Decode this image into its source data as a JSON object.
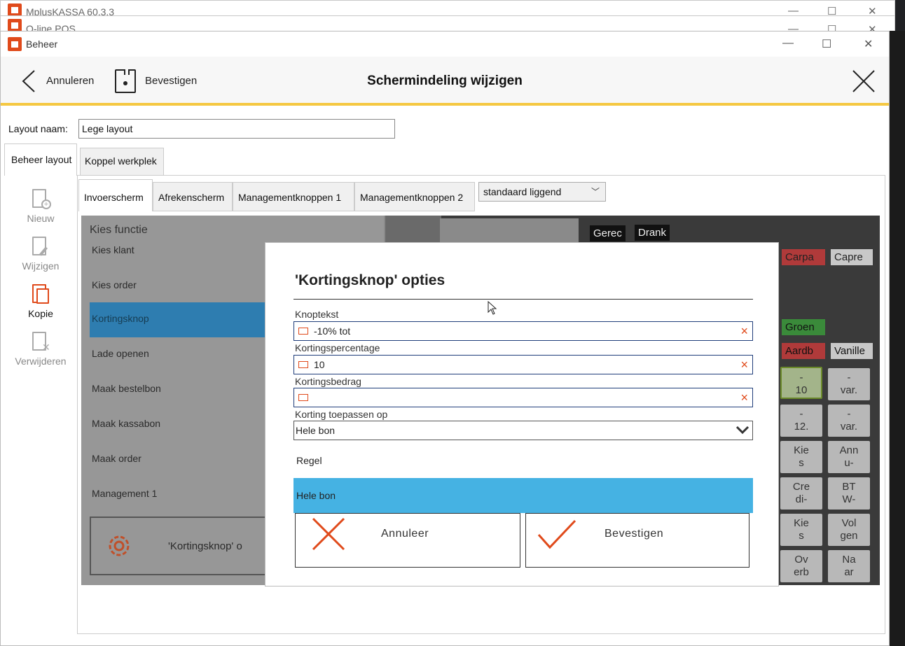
{
  "background_windows": [
    {
      "title": "MplusKASSA 60.3.3"
    },
    {
      "title": "Q-line POS"
    }
  ],
  "window": {
    "title": "Beheer",
    "controls": {
      "minimize": "—",
      "maximize": "☐",
      "close": "✕"
    }
  },
  "header": {
    "cancel_label": "Annuleren",
    "confirm_label": "Bevestigen",
    "title": "Schermindeling wijzigen"
  },
  "layout_name": {
    "label": "Layout naam:",
    "value": "Lege layout"
  },
  "top_tabs": [
    {
      "label": "Beheer layout",
      "active": true
    },
    {
      "label": "Koppel werkplek",
      "active": false
    }
  ],
  "sidebar": {
    "items": [
      {
        "label": "Nieuw",
        "icon": "new-document-icon",
        "enabled": false
      },
      {
        "label": "Wijzigen",
        "icon": "edit-document-icon",
        "enabled": false
      },
      {
        "label": "Kopie",
        "icon": "copy-document-icon",
        "enabled": true
      },
      {
        "label": "Verwijderen",
        "icon": "delete-document-icon",
        "enabled": false
      }
    ]
  },
  "sub_tabs": [
    {
      "label": "Invoerscherm",
      "active": true
    },
    {
      "label": "Afrekenscherm",
      "active": false
    },
    {
      "label": "Managementknoppen 1",
      "active": false
    },
    {
      "label": "Managementknoppen 2",
      "active": false
    }
  ],
  "orientation_select": {
    "value": "standaard liggend"
  },
  "function_list": {
    "title": "Kies functie",
    "items": [
      "Kies klant",
      "Kies order",
      "Kortingsknop",
      "Lade openen",
      "Maak bestelbon",
      "Maak kassabon",
      "Maak order",
      "Management 1"
    ],
    "selected": "Kortingsknop",
    "bottom_button": "'Kortingsknop' o"
  },
  "grid_buttons": {
    "top": [
      "Gerec",
      "Drank"
    ],
    "row_b": [
      "Carpa",
      "Capre"
    ],
    "row_d": [
      "Groen"
    ],
    "row_e": [
      "Aardb",
      "Vanille"
    ],
    "keys": [
      [
        "-\n10",
        "-\nvar."
      ],
      [
        "-\n12.",
        "-\nvar."
      ],
      [
        "Kie\ns",
        "Ann\nu-"
      ],
      [
        "Cre\ndi-",
        "BT\nW-"
      ],
      [
        "Kie\ns",
        "Vol\ngen"
      ],
      [
        "Ov\nerb",
        "Na\nar"
      ]
    ]
  },
  "dialog": {
    "title": "'Kortingsknop' opties",
    "fields": [
      {
        "label": "Knoptekst",
        "value": "-10% tot"
      },
      {
        "label": "Kortingspercentage",
        "value": "10"
      },
      {
        "label": "Kortingsbedrag",
        "value": ""
      }
    ],
    "apply_label": "Korting toepassen op",
    "apply_value": "Hele bon",
    "options": [
      "Regel",
      "Hele bon"
    ],
    "selected_option": "Hele bon",
    "cancel_label": "Annuleer",
    "confirm_label": "Bevestigen"
  },
  "colors": {
    "accent": "#e04a1b",
    "header_underline": "#f5c842",
    "selection_blue": "#45b2e3",
    "input_border": "#1f3d7a"
  }
}
